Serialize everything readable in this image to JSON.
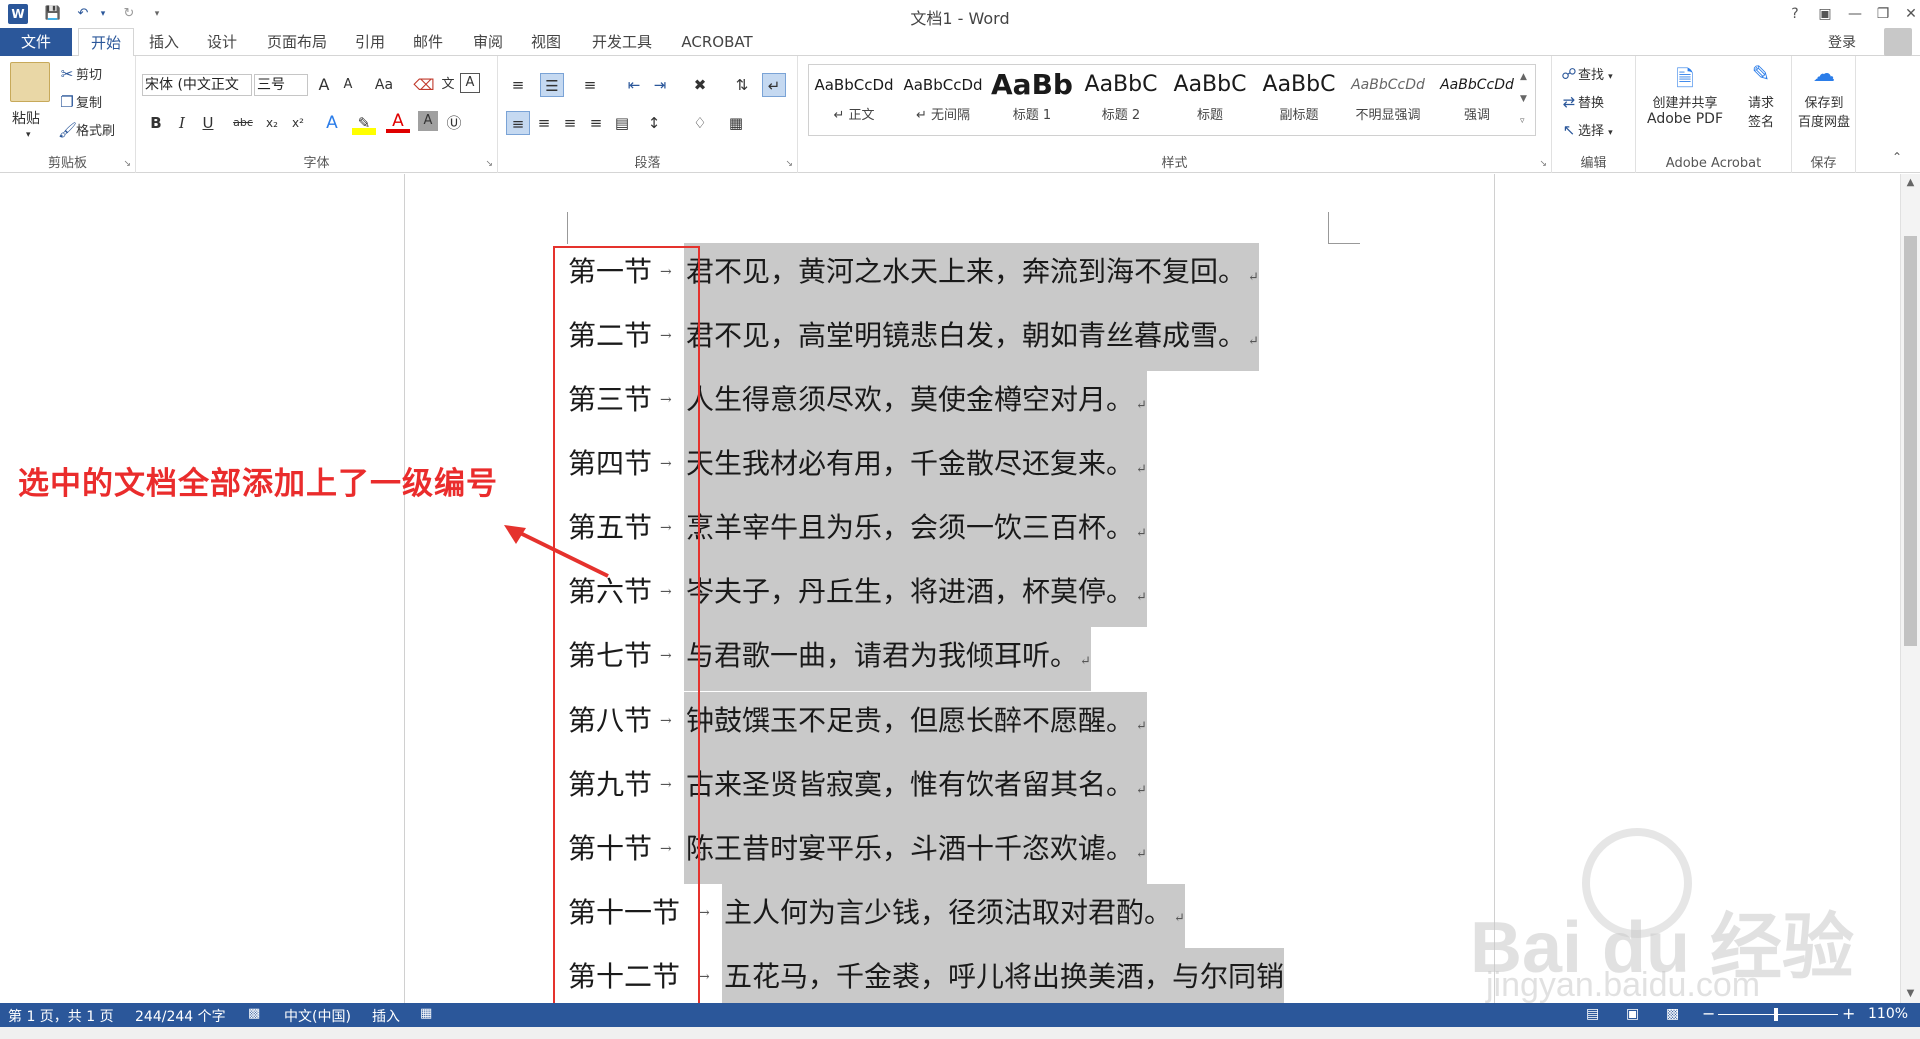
{
  "app": {
    "title": "文档1 - Word",
    "help_label": "?",
    "word_icon_letter": "W"
  },
  "tabs": [
    {
      "label": "文件"
    },
    {
      "label": "开始"
    },
    {
      "label": "插入"
    },
    {
      "label": "设计"
    },
    {
      "label": "页面布局"
    },
    {
      "label": "引用"
    },
    {
      "label": "邮件"
    },
    {
      "label": "审阅"
    },
    {
      "label": "视图"
    },
    {
      "label": "开发工具"
    },
    {
      "label": "ACROBAT"
    }
  ],
  "account": {
    "login_label": "登录"
  },
  "ribbon": {
    "clipboard": {
      "paste_label": "粘贴",
      "cut_label": "剪切",
      "copy_label": "复制",
      "format_painter_label": "格式刷",
      "group_label": "剪贴板"
    },
    "font": {
      "font_name": "宋体 (中文正文",
      "font_size": "三号",
      "group_label": "字体",
      "bold": "B",
      "italic": "I",
      "underline": "U",
      "strike": "abc",
      "subscript": "x₂",
      "superscript": "x²",
      "grow": "A",
      "shrink": "A",
      "case": "Aa"
    },
    "paragraph": {
      "group_label": "段落"
    },
    "styles": {
      "group_label": "样式",
      "items": [
        {
          "sample": "AaBbCcDd",
          "name": "↵ 正文"
        },
        {
          "sample": "AaBbCcDd",
          "name": "↵ 无间隔"
        },
        {
          "sample": "AaBb",
          "name": "标题 1"
        },
        {
          "sample": "AaBbC",
          "name": "标题 2"
        },
        {
          "sample": "AaBbC",
          "name": "标题"
        },
        {
          "sample": "AaBbC",
          "name": "副标题"
        },
        {
          "sample": "AaBbCcDd",
          "name": "不明显强调"
        },
        {
          "sample": "AaBbCcDd",
          "name": "强调"
        }
      ]
    },
    "editing": {
      "find_label": "查找",
      "replace_label": "替换",
      "select_label": "选择",
      "group_label": "编辑"
    },
    "acrobat": {
      "create_line1": "创建并共享",
      "create_line2": "Adobe PDF",
      "sign_line1": "请求",
      "sign_line2": "签名",
      "group_label": "Adobe Acrobat"
    },
    "save": {
      "line1": "保存到",
      "line2": "百度网盘",
      "group_label": "保存"
    }
  },
  "document": {
    "lines": [
      {
        "number": "第一节",
        "text": "君不见，黄河之水天上来，奔流到海不复回。"
      },
      {
        "number": "第二节",
        "text": "君不见，高堂明镜悲白发，朝如青丝暮成雪。"
      },
      {
        "number": "第三节",
        "text": "人生得意须尽欢，莫使金樽空对月。"
      },
      {
        "number": "第四节",
        "text": "天生我材必有用，千金散尽还复来。"
      },
      {
        "number": "第五节",
        "text": "烹羊宰牛且为乐，会须一饮三百杯。"
      },
      {
        "number": "第六节",
        "text": "岑夫子，丹丘生，将进酒，杯莫停。"
      },
      {
        "number": "第七节",
        "text": "与君歌一曲，请君为我倾耳听。"
      },
      {
        "number": "第八节",
        "text": "钟鼓馔玉不足贵，但愿长醉不愿醒。"
      },
      {
        "number": "第九节",
        "text": "古来圣贤皆寂寞，惟有饮者留其名。"
      },
      {
        "number": "第十节",
        "text": "陈王昔时宴平乐，斗酒十千恣欢谑。"
      },
      {
        "number": "第十一节",
        "text": "主人何为言少钱，径须沽取对君酌。"
      },
      {
        "number": "第十二节",
        "text": "五花马，千金裘，呼儿将出换美酒，与尔同销"
      }
    ],
    "paragraph_mark": "↵",
    "tab_mark": "→"
  },
  "annotation": {
    "text": "选中的文档全部添加上了一级编号",
    "color": "#ea2c2c"
  },
  "status": {
    "page": "第 1 页，共 1 页",
    "words": "244/244 个字",
    "language": "中文(中国)",
    "mode": "插入",
    "zoom": "110%",
    "zoom_minus": "−",
    "zoom_plus": "+"
  },
  "watermark": {
    "logo_text": "Bai du 经验",
    "url": "jingyan.baidu.com"
  },
  "colors": {
    "accent": "#2b579a",
    "selection": "#c9c9c9",
    "red": "#e5322d"
  }
}
